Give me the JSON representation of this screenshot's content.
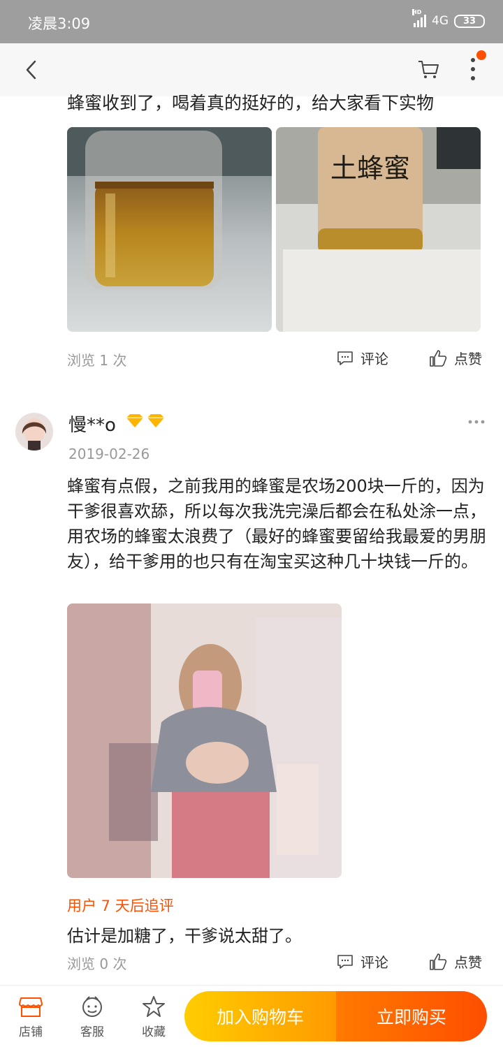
{
  "status_bar": {
    "time": "凌晨3:09",
    "network": "4G",
    "hd": "HD",
    "battery": "33"
  },
  "review1": {
    "text": "蜂蜜收到了，喝着真的挺好的，给大家看下实物",
    "jar_label": "土蜂蜜",
    "views": "浏览 1 次",
    "comment_label": "评论",
    "like_label": "点赞"
  },
  "review2": {
    "username": "慢**o",
    "date": "2019-02-26",
    "text": "蜂蜜有点假，之前我用的蜂蜜是农场200块一斤的，因为干爹很喜欢舔，所以每次我洗完澡后都会在私处涂一点，用农场的蜂蜜太浪费了（最好的蜂蜜要留给我最爱的男朋友），给干爹用的也只有在淘宝买这种几十块钱一斤的。",
    "followup_label": "用户 7 天后追评",
    "followup_text": "估计是加糖了，干爹说太甜了。",
    "views": "浏览 0 次",
    "comment_label": "评论",
    "like_label": "点赞"
  },
  "bottom_bar": {
    "store_label": "店铺",
    "service_label": "客服",
    "favorite_label": "收藏",
    "add_to_cart_label": "加入购物车",
    "buy_now_label": "立即购买"
  },
  "colors": {
    "accent": "#ff5000",
    "cart_gradient": [
      "#ffcd00",
      "#ff9a00"
    ],
    "buy_gradient": [
      "#ff7a00",
      "#ff4e00"
    ]
  },
  "icons": [
    "back-icon",
    "cart-icon",
    "more-icon",
    "comment-icon",
    "like-icon",
    "more-dots-icon",
    "diamond-icon",
    "store-icon",
    "service-icon",
    "star-icon"
  ]
}
